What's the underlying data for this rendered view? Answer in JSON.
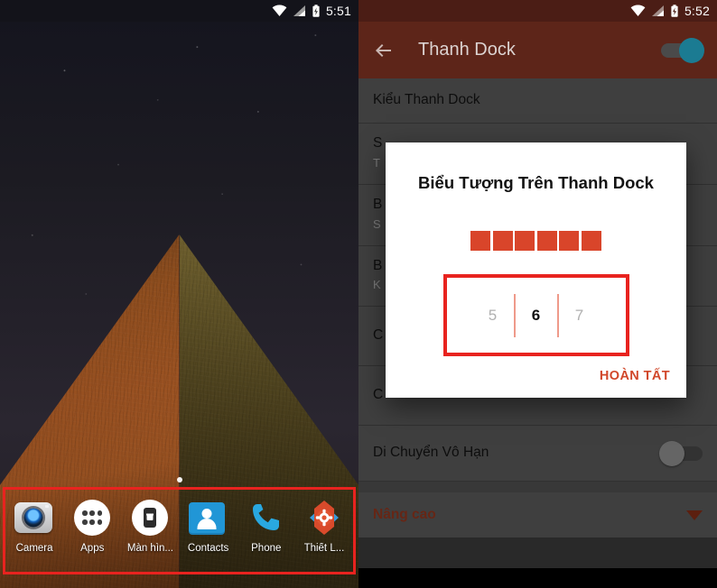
{
  "left_phone": {
    "status_bar": {
      "time": "5:51",
      "icons": [
        "wifi-icon",
        "signal-icon",
        "battery-charging-icon"
      ]
    },
    "wallpaper_alt": "pyramid-night-wallpaper",
    "dock": {
      "highlighted": true,
      "highlight_color": "#e8231f",
      "items": [
        {
          "label": "Camera",
          "icon": "camera-icon"
        },
        {
          "label": "Apps",
          "icon": "apps-grid-icon"
        },
        {
          "label": "Màn hìn...",
          "icon": "screen-lock-icon"
        },
        {
          "label": "Contacts",
          "icon": "contacts-icon"
        },
        {
          "label": "Phone",
          "icon": "phone-icon"
        },
        {
          "label": "Thiết L...",
          "icon": "settings-gear-icon"
        }
      ]
    }
  },
  "right_phone": {
    "status_bar": {
      "time": "5:52",
      "icons": [
        "wifi-icon",
        "signal-icon",
        "battery-charging-icon"
      ]
    },
    "appbar": {
      "back_icon": "back-arrow-icon",
      "title": "Thanh Dock",
      "toggle_state": "on",
      "toggle_color": "#1b7b92",
      "background": "#5d2519"
    },
    "settings_rows": [
      {
        "title": "Kiểu Thanh Dock",
        "subtitle": ""
      },
      {
        "title": "S",
        "subtitle": "T"
      },
      {
        "title": "B",
        "subtitle": "S"
      },
      {
        "title": "B",
        "subtitle": "K"
      },
      {
        "title": "C",
        "subtitle": ""
      },
      {
        "title": "C",
        "subtitle": ""
      }
    ],
    "infinite_scroll_row": {
      "title": "Di Chuyển Vô Hạn",
      "toggle_state": "off"
    },
    "advanced_row": {
      "title": "Nâng cao",
      "icon": "chevron-down-icon",
      "color": "#9c3a21"
    }
  },
  "dialog": {
    "title": "Biểu Tượng Trên Thanh Dock",
    "preview": {
      "count": 6,
      "color": "#d9452a"
    },
    "picker": {
      "previous": "5",
      "selected": "6",
      "next": "7",
      "highlight_color": "#e8231f"
    },
    "confirm_label": "HOÀN TẤT"
  }
}
